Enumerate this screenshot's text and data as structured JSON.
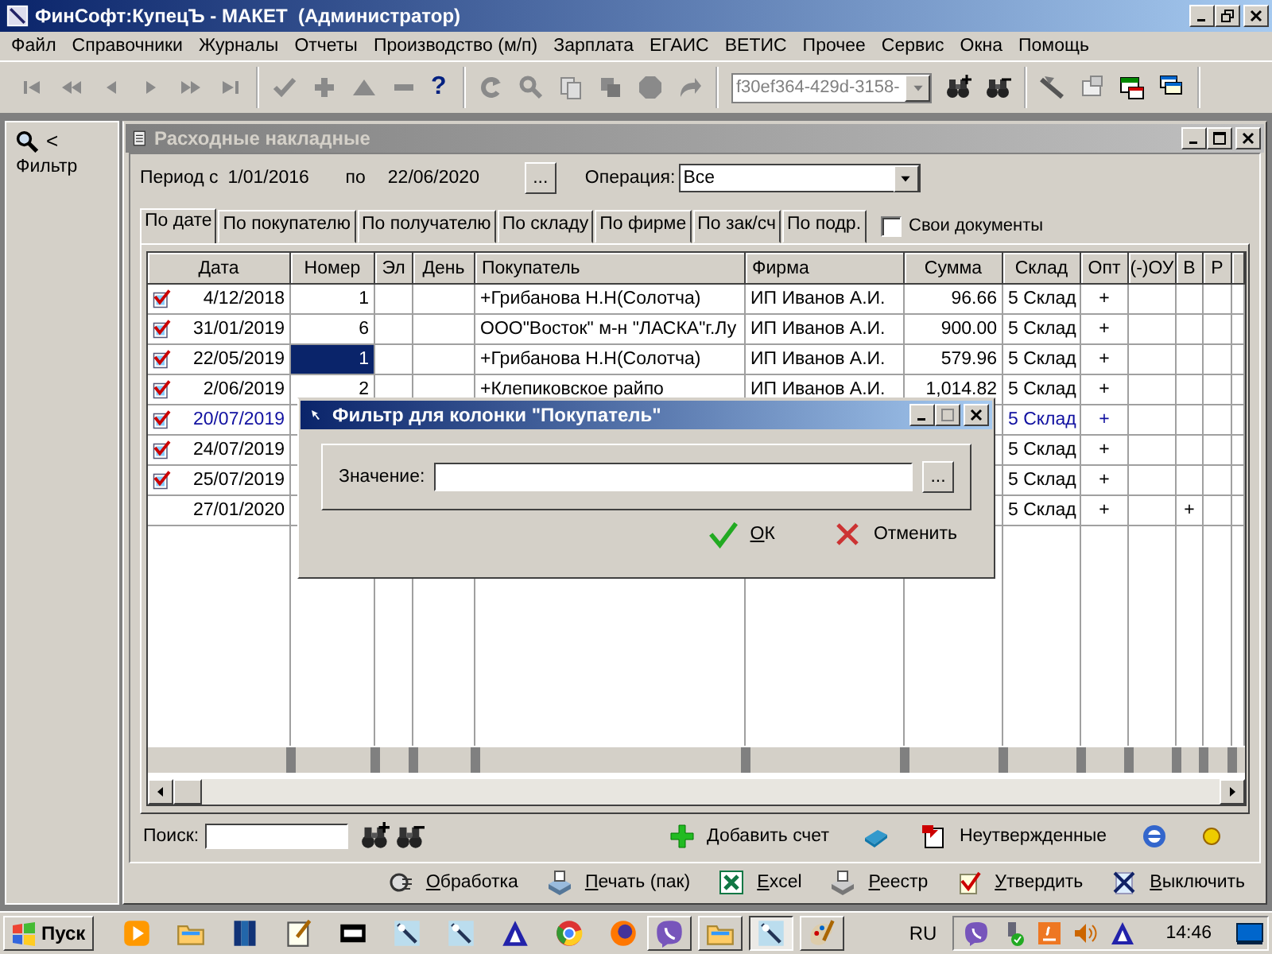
{
  "window": {
    "title": "ФинСофт:КупецЪ - МАКЕТ  (Администратор)"
  },
  "menu": [
    "Файл",
    "Справочники",
    "Журналы",
    "Отчеты",
    "Производство (м/п)",
    "Зарплата",
    "ЕГАИС",
    "ВЕТИС",
    "Прочее",
    "Сервис",
    "Окна",
    "Помощь"
  ],
  "toolbar": {
    "help": "?",
    "combo_value": "f30ef364-429d-3158-"
  },
  "filter_panel": {
    "arrow": "<",
    "label": "Фильтр"
  },
  "document": {
    "title": "Расходные накладные",
    "period_label": "Период с",
    "date_from": "1/01/2016",
    "to_label": "по",
    "date_to": "22/06/2020",
    "picker": "...",
    "operation_label": "Операция:",
    "operation_value": "Все"
  },
  "tabs": [
    {
      "label": "По дате",
      "selected": true
    },
    {
      "label": "По покупателю",
      "selected": false
    },
    {
      "label": "По получателю",
      "selected": false
    },
    {
      "label": "По складу",
      "selected": false
    },
    {
      "label": "По фирме",
      "selected": false
    },
    {
      "label": "По зак/сч",
      "selected": false
    },
    {
      "label": "По подр.",
      "selected": false
    }
  ],
  "own_documents": {
    "label": "Свои документы",
    "checked": false
  },
  "table": {
    "columns": [
      "Дата",
      "Номер",
      "Эл",
      "День",
      "Покупатель",
      "Фирма",
      "Сумма",
      "Склад",
      "Опт",
      "(-)ОУ",
      "В",
      "Р"
    ],
    "rows": [
      {
        "approved": true,
        "highlighted": false,
        "selected": false,
        "cells": {
          "date": "4/12/2018",
          "number": "1",
          "buyer": "+Грибанова  Н.Н(Солотча)",
          "firm": "ИП Иванов А.И.",
          "sum": "96.66",
          "store": "5 Склад",
          "opt": "+"
        }
      },
      {
        "approved": true,
        "highlighted": false,
        "selected": false,
        "cells": {
          "date": "31/01/2019",
          "number": "6",
          "buyer": "ООО\"Восток\" м-н \"ЛАСКА\"г.Лу",
          "firm": "ИП Иванов А.И.",
          "sum": "900.00",
          "store": "5 Склад",
          "opt": "+"
        }
      },
      {
        "approved": true,
        "highlighted": false,
        "selected": true,
        "cells": {
          "date": "22/05/2019",
          "number": "1",
          "buyer": "+Грибанова  Н.Н(Солотча)",
          "firm": "ИП Иванов А.И.",
          "sum": "579.96",
          "store": "5 Склад",
          "opt": "+"
        }
      },
      {
        "approved": true,
        "highlighted": false,
        "selected": false,
        "cells": {
          "date": "2/06/2019",
          "number": "2",
          "buyer": "+Клепиковское райпо",
          "firm": "ИП Иванов А.И.",
          "sum": "1,014.82",
          "store": "5 Склад",
          "opt": "+"
        }
      },
      {
        "approved": true,
        "highlighted": true,
        "selected": false,
        "cells": {
          "date": "20/07/2019",
          "store": "5 Склад",
          "opt": "+"
        }
      },
      {
        "approved": true,
        "highlighted": false,
        "selected": false,
        "cells": {
          "date": "24/07/2019",
          "store": "5 Склад",
          "opt": "+"
        }
      },
      {
        "approved": true,
        "highlighted": false,
        "selected": false,
        "cells": {
          "date": "25/07/2019",
          "store": "5 Склад",
          "opt": "+"
        }
      },
      {
        "approved": false,
        "highlighted": false,
        "selected": false,
        "cells": {
          "date": "27/01/2020",
          "store": "5 Склад",
          "opt": "+",
          "v": "+"
        }
      }
    ]
  },
  "search": {
    "label": "Поиск:"
  },
  "actions": [
    {
      "kind": "add",
      "label": "Добавить счет"
    },
    {
      "kind": "book"
    },
    {
      "kind": "unapproved",
      "label": "Неутвержденные"
    },
    {
      "kind": "e"
    },
    {
      "kind": "dot"
    }
  ],
  "buttons": [
    {
      "kind": "process",
      "label": "Обработка"
    },
    {
      "kind": "print",
      "label": "Печать (пак)"
    },
    {
      "kind": "excel",
      "label": "Excel"
    },
    {
      "kind": "registry",
      "label": "Реестр"
    },
    {
      "kind": "approve",
      "label": "Утвердить"
    },
    {
      "kind": "off",
      "label": "Выключить"
    }
  ],
  "dialog": {
    "title": "Фильтр для колонки \"Покупатель\"",
    "value_label": "Значение:",
    "browse": "...",
    "ok": "ОК",
    "cancel": "Отменить"
  },
  "taskbar": {
    "start": "Пуск",
    "quick_launch": [
      {
        "kind": "media"
      },
      {
        "kind": "folder"
      },
      {
        "kind": "books"
      },
      {
        "kind": "notepad"
      },
      {
        "kind": "archive"
      },
      {
        "kind": "app"
      },
      {
        "kind": "app"
      },
      {
        "kind": "triangle"
      },
      {
        "kind": "globe"
      },
      {
        "kind": "fox"
      }
    ],
    "tasks": [
      {
        "kind": "chat",
        "selected": false
      },
      {
        "kind": "folder",
        "selected": false
      },
      {
        "kind": "app",
        "selected": true
      },
      {
        "kind": "paint",
        "selected": false
      }
    ],
    "language": "RU",
    "tray": [
      {
        "kind": "chat"
      },
      {
        "kind": "usb"
      },
      {
        "kind": "java"
      },
      {
        "kind": "speaker"
      },
      {
        "kind": "triangle"
      }
    ],
    "clock": "14:46"
  }
}
